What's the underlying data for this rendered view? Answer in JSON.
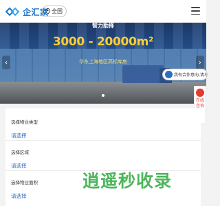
{
  "header": {
    "logo_text": "企汇家",
    "city": "全国",
    "colors": {
      "brand": "#1a73c9"
    }
  },
  "banner": {
    "title": "智力助择",
    "range": "3000 - 20000m²",
    "subtitle": "华东上海地区高标库房",
    "slide_count": 1,
    "active_slide": 1
  },
  "floating": {
    "consult_text": "我有合作意向,请与我联系",
    "online_consult": "在线咨询"
  },
  "form": {
    "fields": [
      {
        "label": "选择物业类型",
        "value": "请选择"
      },
      {
        "label": "选择区域",
        "value": "请选择"
      },
      {
        "label": "选择物业面积",
        "value": "请选择"
      }
    ]
  },
  "watermark": "逍遥秒收录"
}
